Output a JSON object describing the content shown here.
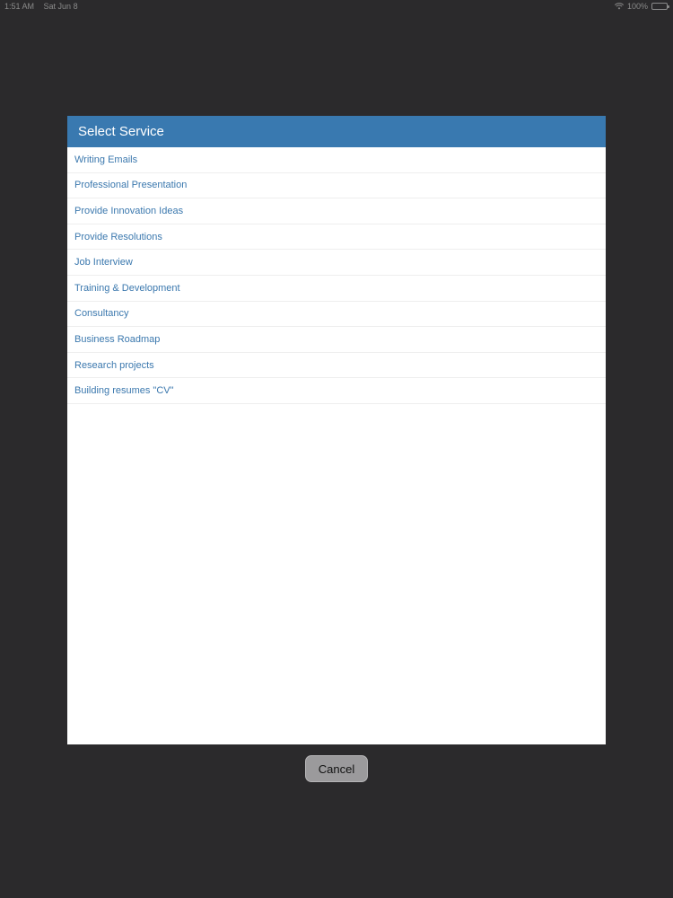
{
  "status_bar": {
    "time": "1:51 AM",
    "date": "Sat Jun 8",
    "battery_text": "100%",
    "wifi_icon": "wifi-icon",
    "battery_icon": "battery-icon"
  },
  "dialog": {
    "title": "Select Service",
    "header_color": "#3979b0",
    "item_color": "#3b78ae",
    "items": [
      {
        "label": "Writing Emails"
      },
      {
        "label": "Professional Presentation"
      },
      {
        "label": "Provide Innovation Ideas"
      },
      {
        "label": "Provide Resolutions"
      },
      {
        "label": "Job Interview"
      },
      {
        "label": "Training & Development"
      },
      {
        "label": "Consultancy"
      },
      {
        "label": "Business Roadmap"
      },
      {
        "label": "Research projects"
      },
      {
        "label": "Building resumes \"CV\""
      }
    ]
  },
  "actions": {
    "cancel_label": "Cancel"
  }
}
